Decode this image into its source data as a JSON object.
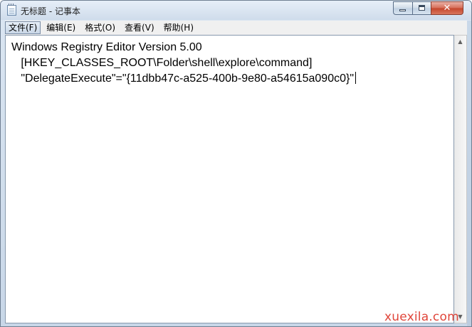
{
  "window": {
    "title": "无标题 - 记事本",
    "icon": "notepad-icon"
  },
  "controls": {
    "minimize_icon": "minimize-icon",
    "maximize_icon": "maximize-icon",
    "close_icon": "close-icon",
    "close_glyph": "✕"
  },
  "menubar": {
    "items": [
      {
        "label": "文件(F)"
      },
      {
        "label": "编辑(E)"
      },
      {
        "label": "格式(O)"
      },
      {
        "label": "查看(V)"
      },
      {
        "label": "帮助(H)"
      }
    ]
  },
  "editor": {
    "lines": [
      "Windows Registry Editor Version 5.00",
      "   [HKEY_CLASSES_ROOT\\Folder\\shell\\explore\\command]",
      "   \"DelegateExecute\"=\"{11dbb47c-a525-400b-9e80-a54615a090c0}\""
    ]
  },
  "scrollbar": {
    "up_glyph": "▲",
    "down_glyph": "▼"
  },
  "watermark": {
    "text": "xuexila.com"
  },
  "colors": {
    "watermark": "#e0453a",
    "close_button": "#c4452b",
    "title_bar": "#dbe6f2"
  }
}
